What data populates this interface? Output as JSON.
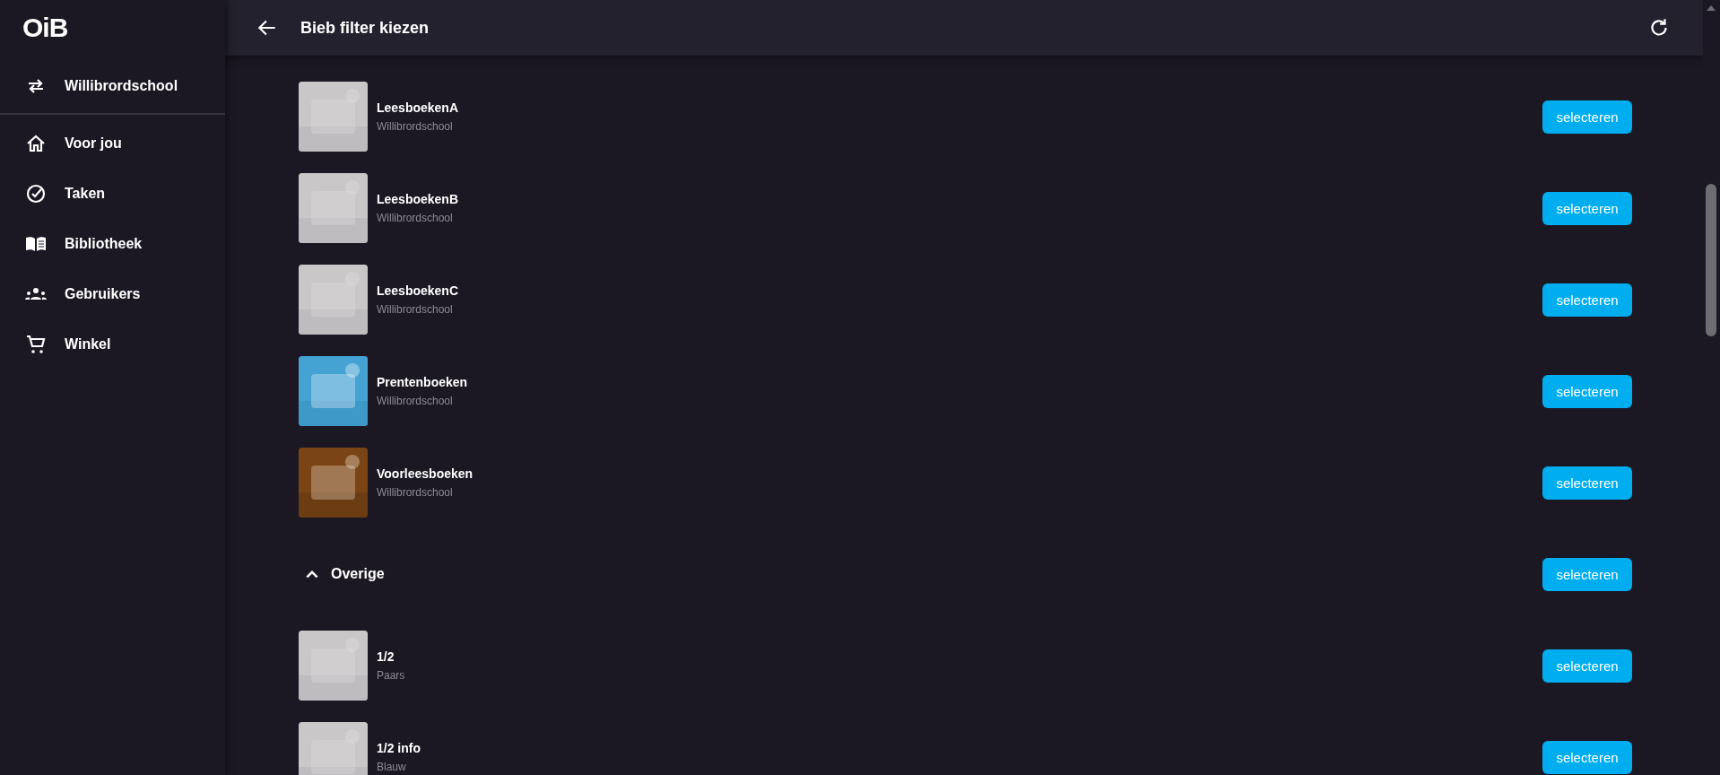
{
  "logo": "OiB",
  "sidebar": {
    "school": "Willibrordschool",
    "items": [
      {
        "label": "Voor jou"
      },
      {
        "label": "Taken"
      },
      {
        "label": "Bibliotheek"
      },
      {
        "label": "Gebruikers"
      },
      {
        "label": "Winkel"
      }
    ]
  },
  "header": {
    "title": "Bieb filter kiezen"
  },
  "filters": [
    {
      "name": "LeesboekenA",
      "subtitle": "Willibrordschool",
      "kind": "grey",
      "button": "selecteren"
    },
    {
      "name": "LeesboekenB",
      "subtitle": "Willibrordschool",
      "kind": "grey",
      "button": "selecteren"
    },
    {
      "name": "LeesboekenC",
      "subtitle": "Willibrordschool",
      "kind": "grey",
      "button": "selecteren"
    },
    {
      "name": "Prentenboeken",
      "subtitle": "Willibrordschool",
      "kind": "blue",
      "button": "selecteren"
    },
    {
      "name": "Voorleesboeken",
      "subtitle": "Willibrordschool",
      "kind": "brown",
      "button": "selecteren"
    }
  ],
  "group": {
    "title": "Overige",
    "expanded": true,
    "button": "selecteren",
    "items": [
      {
        "name": "1/2",
        "subtitle": "Paars",
        "kind": "grey",
        "button": "selecteren"
      },
      {
        "name": "1/2 info",
        "subtitle": "Blauw",
        "kind": "grey",
        "button": "selecteren"
      }
    ]
  }
}
